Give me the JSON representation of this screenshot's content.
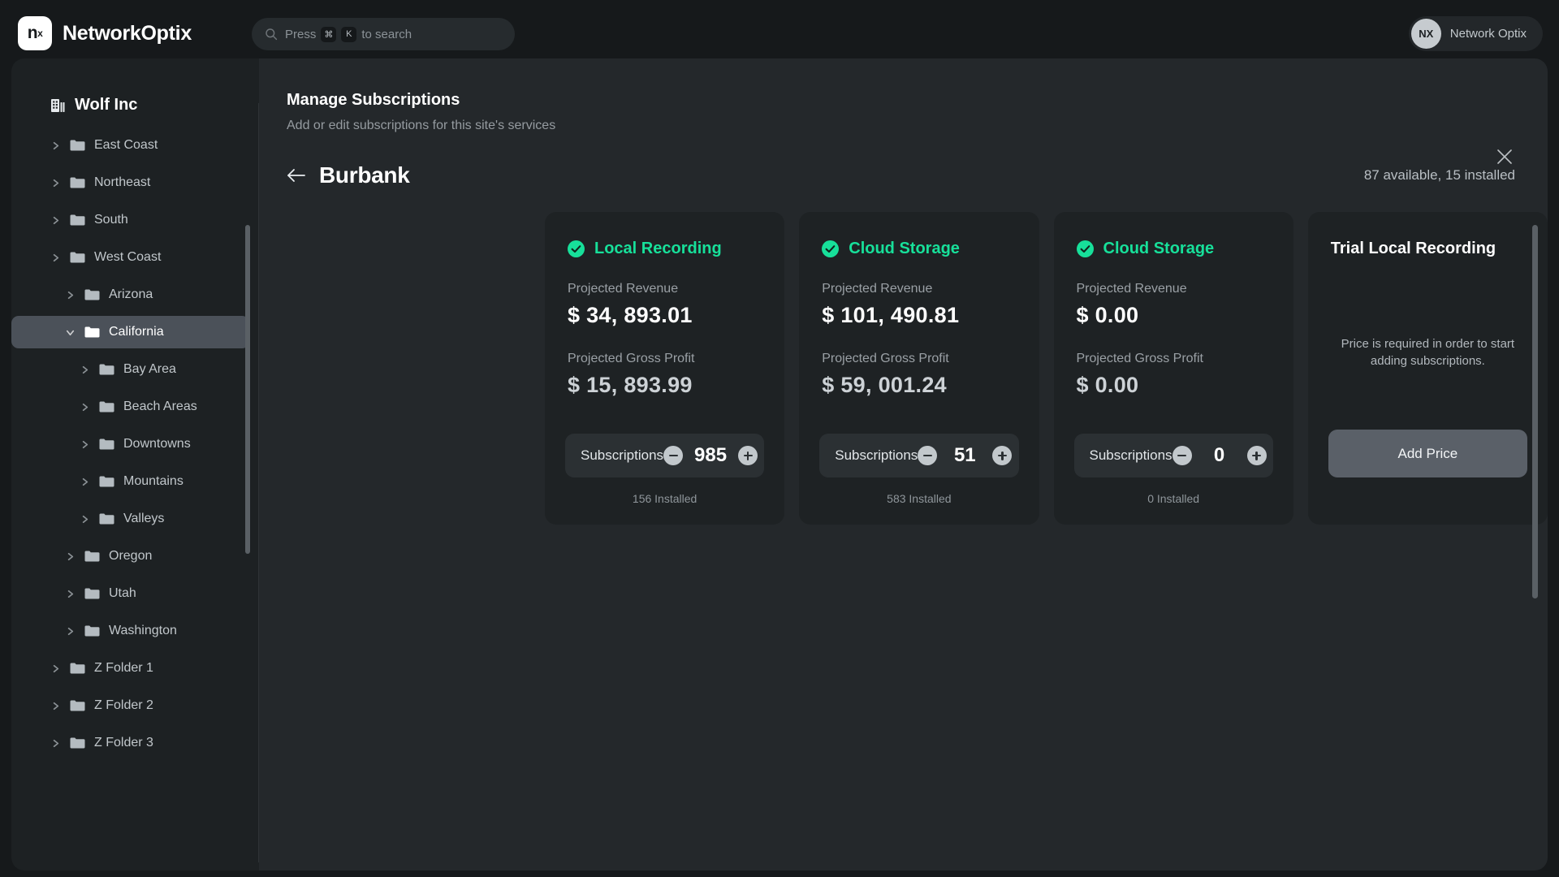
{
  "topbar": {
    "logo_mark": "n",
    "logo_sup": "x",
    "brand_name": "NetworkOptix",
    "search": {
      "icon": "search-icon",
      "prefix": "Press",
      "key1": "⌘",
      "key2": "K",
      "suffix": "to search"
    },
    "account": {
      "avatar_initials": "NX",
      "name": "Network Optix"
    }
  },
  "sidebar": {
    "org_icon": "building-icon",
    "org_name": "Wolf Inc",
    "tree": [
      {
        "label": "East Coast",
        "level": 1,
        "expanded": false,
        "selected": false
      },
      {
        "label": "Northeast",
        "level": 1,
        "expanded": false,
        "selected": false
      },
      {
        "label": "South",
        "level": 1,
        "expanded": false,
        "selected": false
      },
      {
        "label": "West Coast",
        "level": 1,
        "expanded": false,
        "selected": false
      },
      {
        "label": "Arizona",
        "level": 2,
        "expanded": false,
        "selected": false
      },
      {
        "label": "California",
        "level": 2,
        "expanded": true,
        "selected": true
      },
      {
        "label": "Bay Area",
        "level": 3,
        "expanded": false,
        "selected": false
      },
      {
        "label": "Beach Areas",
        "level": 3,
        "expanded": false,
        "selected": false
      },
      {
        "label": "Downtowns",
        "level": 3,
        "expanded": false,
        "selected": false
      },
      {
        "label": "Mountains",
        "level": 3,
        "expanded": false,
        "selected": false
      },
      {
        "label": "Valleys",
        "level": 3,
        "expanded": false,
        "selected": false
      },
      {
        "label": "Oregon",
        "level": 2,
        "expanded": false,
        "selected": false
      },
      {
        "label": "Utah",
        "level": 2,
        "expanded": false,
        "selected": false
      },
      {
        "label": "Washington",
        "level": 2,
        "expanded": false,
        "selected": false
      },
      {
        "label": "Z Folder 1",
        "level": 1,
        "expanded": false,
        "selected": false
      },
      {
        "label": "Z Folder 2",
        "level": 1,
        "expanded": false,
        "selected": false
      },
      {
        "label": "Z Folder 3",
        "level": 1,
        "expanded": false,
        "selected": false
      }
    ]
  },
  "panel": {
    "title": "Manage Subscriptions",
    "subtitle": "Add or edit subscriptions for this site's services",
    "close_icon": "close-icon",
    "back_icon": "arrow-left-icon",
    "site_name": "Burbank",
    "availability": "87 available, 15 installed"
  },
  "colors": {
    "accent_green": "#17e09a",
    "page_bg": "#16191b",
    "panel_bg": "#24282b",
    "card_bg": "#1e2224",
    "sidebar_bg": "#1d2123",
    "selected_item": "#4b5159",
    "button_gray": "#5a6068"
  },
  "cards": [
    {
      "title": "Local Recording",
      "has_check": true,
      "revenue_label": "Projected Revenue",
      "revenue_value": "$ 34, 893.01",
      "profit_label": "Projected Gross Profit",
      "profit_value": "$ 15, 893.99",
      "stepper_label": "Subscriptions",
      "count": "985",
      "installed": "156 Installed"
    },
    {
      "title": "Cloud Storage",
      "has_check": true,
      "revenue_label": "Projected Revenue",
      "revenue_value": "$ 101, 490.81",
      "profit_label": "Projected Gross Profit",
      "profit_value": "$ 59, 001.24",
      "stepper_label": "Subscriptions",
      "count": "51",
      "installed": "583 Installed"
    },
    {
      "title": "Cloud Storage",
      "has_check": true,
      "revenue_label": "Projected Revenue",
      "revenue_value": "$ 0.00",
      "profit_label": "Projected Gross Profit",
      "profit_value": "$ 0.00",
      "stepper_label": "Subscriptions",
      "count": "0",
      "installed": "0 Installed"
    },
    {
      "title": "Trial Local Recording",
      "has_check": false,
      "message": "Price is required in order to start adding subscriptions.",
      "button_label": "Add Price"
    }
  ]
}
